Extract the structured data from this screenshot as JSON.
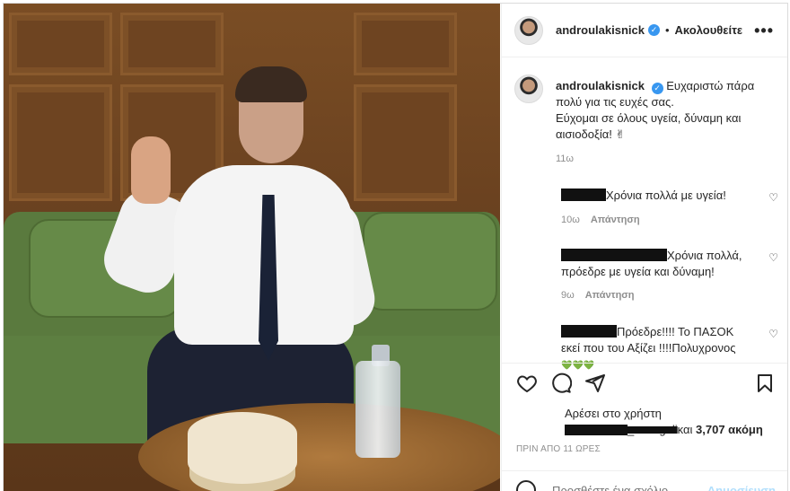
{
  "header": {
    "username": "androulakisnick",
    "separator": "•",
    "follow_label": "Ακολουθείτε",
    "more_label": "•••"
  },
  "caption": {
    "username": "androulakisnick",
    "lines": [
      "Ευχαριστώ πάρα",
      "πολύ για τις ευχές σας.",
      "Εύχομαι σε όλους υγεία, δύναμη και",
      "αισιοδοξία! ✌"
    ],
    "time": "11ω"
  },
  "comments": [
    {
      "text_lines": [
        "Χρόνια πολλά με υγεία!"
      ],
      "time": "10ω",
      "reply_label": "Απάντηση"
    },
    {
      "text_lines": [
        "Χρόνια πολλά,",
        "πρόεδρε με υγεία και δύναμη!"
      ],
      "time": "9ω",
      "reply_label": "Απάντηση"
    },
    {
      "text_lines": [
        "Πρόεδρε!!!! Το ΠΑΣΟΚ",
        "εκεί που του Αξίζει !!!!Πολυχρονος"
      ],
      "emoji": "💚💚💚"
    }
  ],
  "likes": {
    "line1": "Αρέσει στο χρήστη",
    "line2_visible": "_evangeli",
    "line2_suffix": "και ",
    "count": "3,707 ακόμη"
  },
  "age": "ΠΡΙΝ ΑΠΟ 11 ΩΡΕΣ",
  "comment_box": {
    "placeholder": "Προσθέστε ένα σχόλιο...",
    "post_label": "Δημοσίευση"
  },
  "icons": {
    "heart": "heart-icon",
    "comment": "comment-icon",
    "share": "share-icon",
    "save": "save-icon",
    "verified": "verified-icon",
    "emoji": "emoji-icon"
  },
  "colors": {
    "verified": "#3897f0",
    "muted": "#8e8e8e",
    "post_button": "#b2dffc"
  }
}
